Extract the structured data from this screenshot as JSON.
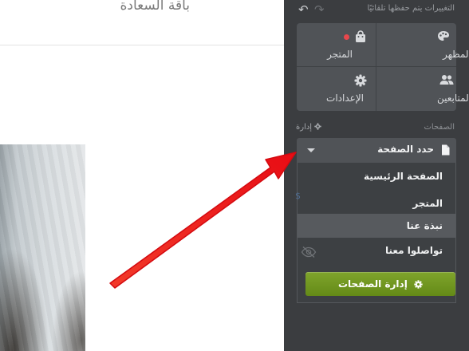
{
  "site": {
    "title": "باقة السعادة"
  },
  "panel": {
    "autosave_text": "التغييرات يتم حفظها تلقائيًا",
    "undo_glyph": "↶",
    "redo_glyph": "↷",
    "nav": {
      "appearance_label": "المظهر",
      "store_label": "المتجر",
      "followers_label": "المتابعين",
      "settings_label": "الإعدادات"
    },
    "pages_label": "الصفحات",
    "manage_label": "إدارة",
    "page_select_label": "حدد الصفحة",
    "dropdown_items": [
      "الصفحة الرئيسية",
      "المتجر",
      "نبذة عنا",
      "تواصلوا معنا"
    ],
    "manage_pages_button": "إدارة الصفحات",
    "selected_item": "نبذة عنا"
  },
  "colors": {
    "panel_bg": "#3b3d40",
    "accent_green": "#6f961f",
    "notification_dot": "#e8474c",
    "arrow_red": "#ee1c1c"
  },
  "icons": {
    "palette": "palette-icon",
    "store": "shopping-bag-icon",
    "followers": "people-icon",
    "settings": "gear-icon",
    "page": "page-icon",
    "hidden": "eye-slash-icon"
  }
}
